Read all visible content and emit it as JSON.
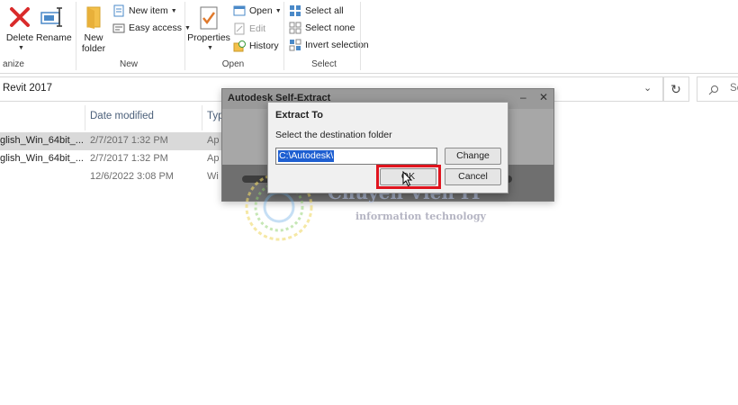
{
  "ribbon": {
    "organize": {
      "label": "anize",
      "delete_label": "Delete",
      "rename_label": "Rename"
    },
    "new": {
      "label": "New",
      "new_folder_label": "New\nfolder",
      "new_item_label": "New item",
      "easy_access_label": "Easy access"
    },
    "open": {
      "label": "Open",
      "properties_label": "Properties",
      "open_label": "Open",
      "edit_label": "Edit",
      "history_label": "History"
    },
    "select": {
      "label": "Select",
      "select_all_label": "Select all",
      "select_none_label": "Select none",
      "invert_label": "Invert selection"
    }
  },
  "address": {
    "path": "Revit 2017",
    "search_placeholder": "Se"
  },
  "file_list": {
    "headers": {
      "date": "Date modified",
      "type": "Typ"
    },
    "rows": [
      {
        "name": "glish_Win_64bit_...",
        "date": "2/7/2017 1:32 PM",
        "type": "Ap",
        "selected": true
      },
      {
        "name": "glish_Win_64bit_...",
        "date": "2/7/2017 1:32 PM",
        "type": "Ap",
        "selected": false
      },
      {
        "name": "",
        "date": "12/6/2022 3:08 PM",
        "type": "Wi",
        "selected": false
      }
    ]
  },
  "background_window": {
    "title": "Autodesk Self-Extract"
  },
  "dialog": {
    "title": "Extract To",
    "prompt": "Select the destination folder",
    "path_value": "C:\\Autodesk\\",
    "change_label": "Change",
    "ok_label": "OK",
    "cancel_label": "Cancel"
  },
  "watermark": {
    "brand": "Chuyên Viên IT",
    "tagline": "information technology"
  },
  "colors": {
    "highlight_red": "#e0141e",
    "selection_blue": "#1e5fd1",
    "delete_red": "#d92b2b"
  }
}
